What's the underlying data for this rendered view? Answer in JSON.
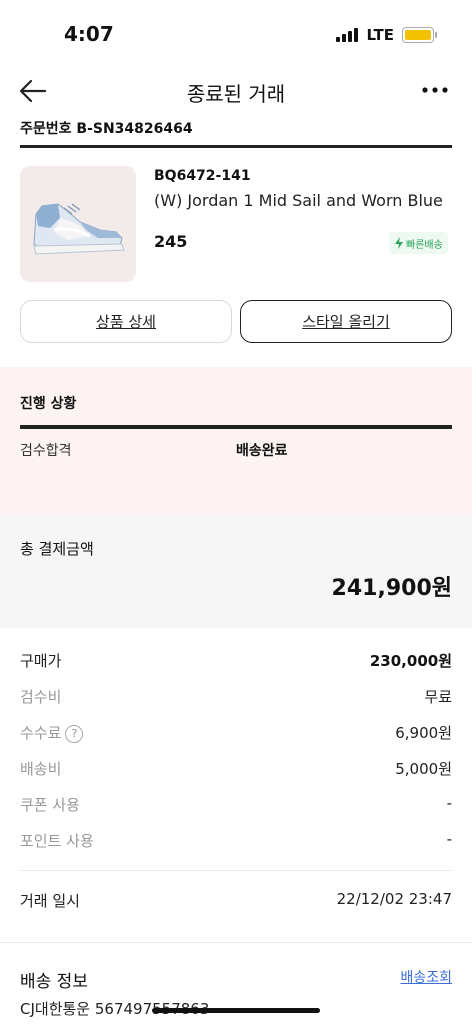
{
  "status_bar": {
    "time": "4:07",
    "network": "LTE"
  },
  "nav": {
    "title": "종료된 거래"
  },
  "order": {
    "number_text": "주문번호 B-SN34826464"
  },
  "product": {
    "model": "BQ6472-141",
    "name": "(W) Jordan 1 Mid Sail and Worn Blue",
    "size": "245",
    "badge": "빠른배송"
  },
  "buttons": {
    "detail": "상품 상세",
    "style": "스타일 올리기"
  },
  "progress": {
    "title": "진행 상황",
    "step1": "검수합격",
    "step2": "배송완료"
  },
  "total": {
    "label": "총 결제금액",
    "value": "241,900원"
  },
  "details": [
    {
      "label": "구매가",
      "value": "230,000원"
    },
    {
      "label": "검수비",
      "value": "무료"
    },
    {
      "label": "수수료",
      "value": "6,900원"
    },
    {
      "label": "배송비",
      "value": "5,000원"
    },
    {
      "label": "쿠폰 사용",
      "value": "-"
    },
    {
      "label": "포인트 사용",
      "value": "-"
    }
  ],
  "help_symbol": "?",
  "trade": {
    "label": "거래 일시",
    "value": "22/12/02 23:47"
  },
  "shipping": {
    "title": "배송 정보",
    "link": "배송조회",
    "carrier": "CJ대한통운 567497557863"
  },
  "colors": {
    "accent_green": "#2aa35a",
    "link_blue": "#3b6fd6",
    "progress_bg": "#fdf3f3",
    "battery": "#f2c200"
  }
}
